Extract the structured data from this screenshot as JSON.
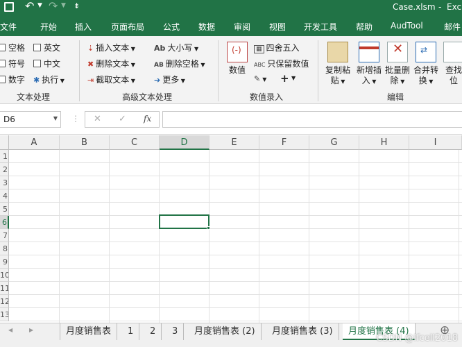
{
  "titlebar": {
    "filename": "Case.xlsm",
    "app": "Exc",
    "dash": "-",
    "save_icon": "save-icon",
    "undo_icon": "undo-icon",
    "redo_icon": "redo-icon",
    "customize_glyph": "⇟"
  },
  "tabs": [
    "文件",
    "开始",
    "插入",
    "页面布局",
    "公式",
    "数据",
    "审阅",
    "视图",
    "开发工具",
    "帮助",
    "AudTool",
    "邮件"
  ],
  "ribbon": {
    "text_group": {
      "label": "文本处理",
      "checks": [
        "空格",
        "英文",
        "符号",
        "中文",
        "数字"
      ],
      "execute": "执行"
    },
    "advanced_group": {
      "label": "高级文本处理",
      "insert_text": "插入文本",
      "delete_text": "删除文本",
      "extract_text": "截取文本",
      "case": "大小写",
      "delete_space": "删除空格",
      "more": "更多",
      "ab_glyph": "Ab",
      "ab2_glyph": "AB"
    },
    "number_group": {
      "label": "数值录入",
      "value": "数值",
      "round": "四舍五入",
      "keep_value": "只保留数值",
      "abc_glyph": "ABC",
      "plus_glyph": "+"
    },
    "edit_group": {
      "label": "编辑",
      "copy_paste": [
        "复制粘",
        "贴"
      ],
      "new_insert": [
        "新增插",
        "入"
      ],
      "batch_delete": [
        "批量删",
        "除"
      ],
      "merge_convert": [
        "合并转",
        "换"
      ],
      "find": [
        "查找",
        "位"
      ]
    }
  },
  "formula_bar": {
    "namebox": "D6",
    "cancel": "✕",
    "confirm": "✓",
    "fx": "fx",
    "value": ""
  },
  "grid": {
    "columns": [
      "A",
      "B",
      "C",
      "D",
      "E",
      "F",
      "G",
      "H",
      "I"
    ],
    "selected_column": "D",
    "rows": [
      "1",
      "2",
      "3",
      "4",
      "5",
      "6",
      "7",
      "8",
      "9",
      "10",
      "11",
      "12",
      "13"
    ],
    "selected_row": "6"
  },
  "sheets": {
    "tabs": [
      "月度销售表",
      "1",
      "2",
      "3",
      "月度销售表 (2)",
      "月度销售表 (3)",
      "月度销售表 (4)"
    ],
    "active": "月度销售表 (4)",
    "add": "⊕",
    "prev": "◀",
    "next": "▶"
  },
  "watermark": "CSDN @lfcell2018"
}
